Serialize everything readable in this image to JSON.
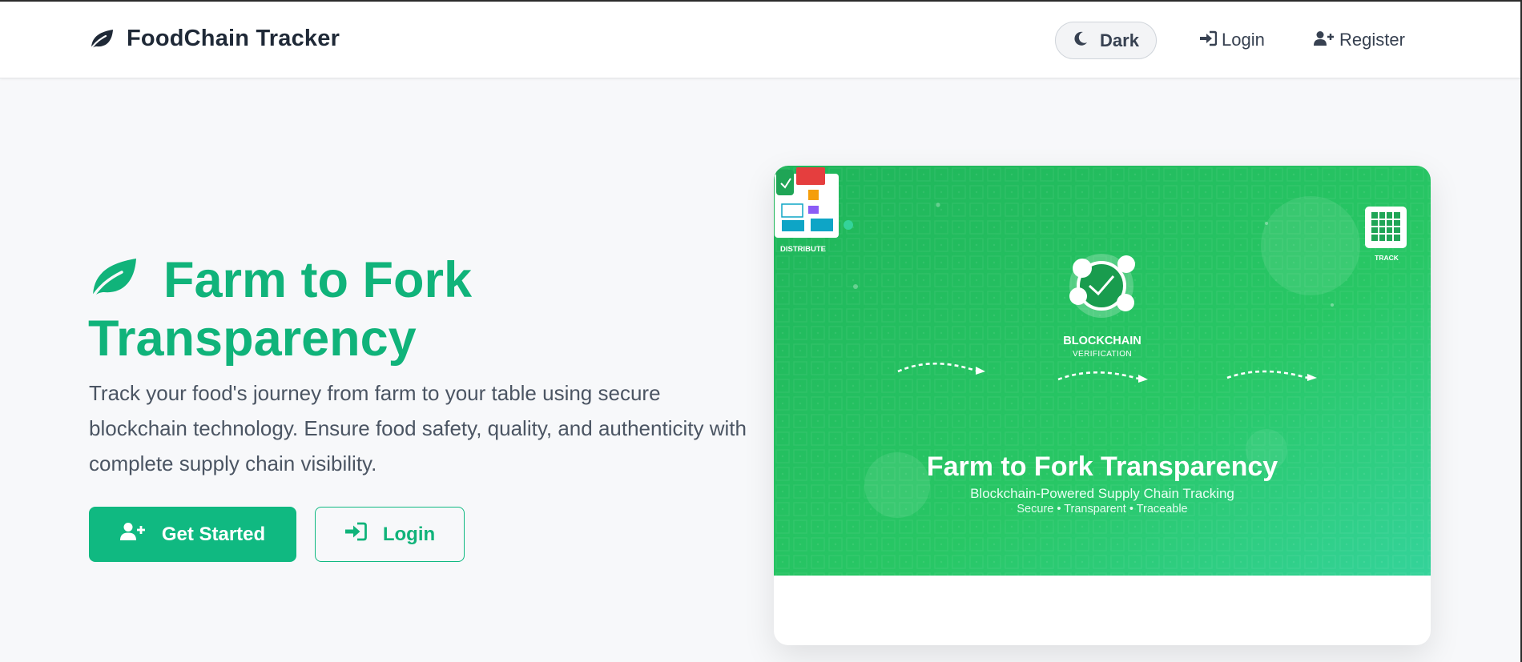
{
  "navbar": {
    "brand_name": "FoodChain Tracker",
    "brand_icon": "leaf-icon",
    "dark_toggle_label": "Dark",
    "dark_toggle_icon": "moon-icon",
    "login_label": "Login",
    "login_icon": "sign-in-icon",
    "register_label": "Register",
    "register_icon": "user-plus-icon"
  },
  "hero": {
    "title": "Farm to Fork Transparency",
    "title_icon": "leaf-icon",
    "description": "Track your food's journey from farm to your table using secure blockchain technology. Ensure food safety, quality, and authenticity with complete supply chain visibility.",
    "get_started_label": "Get Started",
    "get_started_icon": "user-plus-icon",
    "login_label": "Login",
    "login_icon": "sign-in-icon"
  },
  "illustration": {
    "title": "Farm to Fork Transparency",
    "subtitle": "Blockchain-Powered Supply Chain Tracking",
    "tagline": "Secure • Transparent • Traceable",
    "blockchain_label": "BLOCKCHAIN",
    "blockchain_sub": "VERIFICATION",
    "track_label": "TRACK",
    "stack_label": "DISTRIBUTE"
  },
  "colors": {
    "accent": "#10b981",
    "accent_text": "#10b37a",
    "illustration_green": "#22c55e",
    "page_bg": "#f7f8fa"
  }
}
